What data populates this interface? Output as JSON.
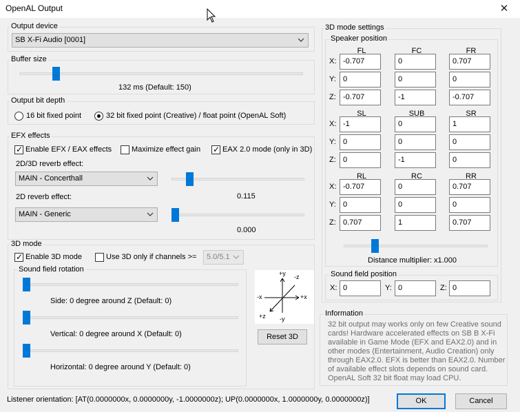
{
  "window": {
    "title": "OpenAL Output",
    "close_glyph": "✕"
  },
  "output_device": {
    "label": "Output device",
    "value": "SB X-Fi Audio [0001]"
  },
  "buffer_size": {
    "label": "Buffer size",
    "value_text": "132 ms (Default: 150)",
    "slider_fraction": 0.12
  },
  "output_bit_depth": {
    "label": "Output bit depth",
    "options": [
      "16 bit fixed point",
      "32 bit fixed point (Creative) / float point (OpenAL Soft)"
    ],
    "selected_index": 1
  },
  "efx": {
    "label": "EFX effects",
    "enable_label": "Enable EFX / EAX effects",
    "enable_checked": true,
    "maximize_label": "Maximize effect gain",
    "maximize_checked": false,
    "eax2_label": "EAX 2.0 mode (only in 3D)",
    "eax2_checked": true,
    "reverb_3d_label": "2D/3D reverb effect:",
    "reverb_3d_value": "MAIN - Concerthall",
    "reverb_3d_amount": "0.115",
    "reverb_3d_fraction": 0.115,
    "reverb_2d_label": "2D reverb effect:",
    "reverb_2d_value": "MAIN - Generic",
    "reverb_2d_amount": "0.000",
    "reverb_2d_fraction": 0.0
  },
  "mode3d": {
    "label": "3D mode",
    "enable_label": "Enable 3D mode",
    "enable_checked": true,
    "use3d_label": "Use 3D only if channels >=",
    "use3d_checked": false,
    "channels_value": "5.0/5.1",
    "rotation_label": "Sound field rotation",
    "side_text": "Side: 0 degree around Z (Default: 0)",
    "vertical_text": "Vertical: 0 degree around X (Default: 0)",
    "horizontal_text": "Horizontal: 0 degree around Y (Default: 0)",
    "rotation_fractions": [
      0.0,
      0.0,
      0.0
    ],
    "axes": {
      "py": "+y",
      "nz": "-z",
      "nx": "-x",
      "px": "+x",
      "pz": "+z",
      "ny": "-y"
    },
    "reset_label": "Reset 3D"
  },
  "settings3d": {
    "label": "3D mode settings",
    "speaker_label": "Speaker position",
    "axis_labels": [
      "X:",
      "Y:",
      "Z:"
    ],
    "groups": [
      {
        "names": [
          "FL",
          "FC",
          "FR"
        ],
        "x": [
          "-0.707",
          "0",
          "0.707"
        ],
        "y": [
          "0",
          "0",
          "0"
        ],
        "z": [
          "-0.707",
          "-1",
          "-0.707"
        ]
      },
      {
        "names": [
          "SL",
          "SUB",
          "SR"
        ],
        "x": [
          "-1",
          "0",
          "1"
        ],
        "y": [
          "0",
          "0",
          "0"
        ],
        "z": [
          "0",
          "-1",
          "0"
        ]
      },
      {
        "names": [
          "RL",
          "RC",
          "RR"
        ],
        "x": [
          "-0.707",
          "0",
          "0.707"
        ],
        "y": [
          "0",
          "0",
          "0"
        ],
        "z": [
          "0.707",
          "1",
          "0.707"
        ]
      }
    ],
    "distance_text": "Distance multiplier: x1.000",
    "distance_fraction": 0.2,
    "field_label": "Sound field position",
    "field_axis_labels": [
      "X:",
      "Y:",
      "Z:"
    ],
    "field_values": [
      "0",
      "0",
      "0"
    ]
  },
  "information": {
    "label": "Information",
    "lines": [
      "32 bit output may works only on few Creative sound",
      "cards! Hardware accelerated effects on SB B X-Fi",
      "available in Game Mode (EFX and EAX2.0) and in",
      "other modes (Entertainment, Audio Creation) only",
      "through EAX2.0. EFX is better than EAX2.0. Number",
      "of available effect slots depends on sound card.",
      "OpenAL Soft 32 bit float may load CPU."
    ]
  },
  "listener": {
    "text": "Listener orientation: [AT(0.0000000x, 0.0000000y, -1.0000000z); UP(0.0000000x, 1.0000000y, 0.0000000z)]"
  },
  "buttons": {
    "ok": "OK",
    "cancel": "Cancel"
  },
  "colors": {
    "accent": "#0078d7",
    "background": "#f0f0f0",
    "info_text": "#6d6d6d"
  }
}
